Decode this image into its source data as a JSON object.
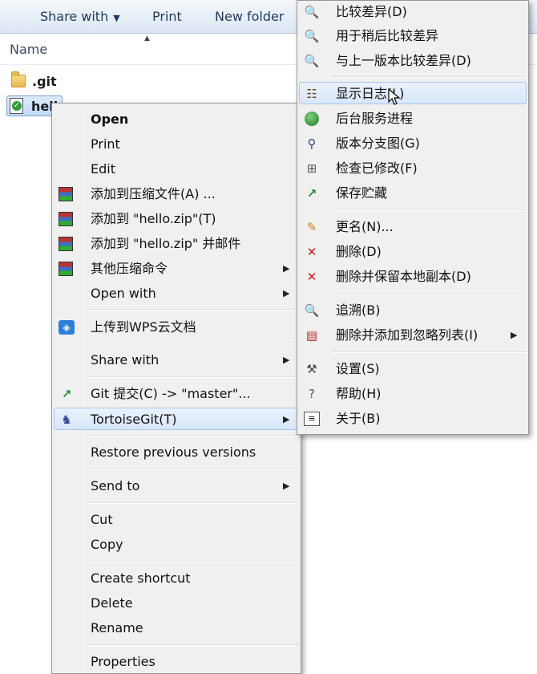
{
  "toolbar": {
    "share_with": "Share with",
    "print": "Print",
    "new_folder": "New folder"
  },
  "file_list": {
    "column_name": "Name",
    "files": [
      {
        "name": ".git",
        "type": "folder"
      },
      {
        "name": "hello.txt",
        "type": "document",
        "visible_text": "hell"
      }
    ]
  },
  "context_menu": {
    "items": [
      {
        "label": "Open",
        "bold": true
      },
      {
        "label": "Print"
      },
      {
        "label": "Edit"
      },
      {
        "label": "添加到压缩文件(A) ...",
        "icon": "archive-icon"
      },
      {
        "label": "添加到 \"hello.zip\"(T)",
        "icon": "archive-icon"
      },
      {
        "label": "添加到 \"hello.zip\" 并邮件",
        "icon": "archive-icon"
      },
      {
        "label": "其他压缩命令",
        "icon": "archive-icon",
        "submenu": true
      },
      {
        "label": "Open with",
        "submenu": true
      },
      {
        "label": "上传到WPS云文档",
        "icon": "wps-cloud-icon"
      },
      {
        "label": "Share with",
        "submenu": true
      },
      {
        "label": "Git 提交(C) -> \"master\"...",
        "icon": "git-commit-icon"
      },
      {
        "label": "TortoiseGit(T)",
        "icon": "tortoisegit-icon",
        "submenu": true
      },
      {
        "label": "Restore previous versions"
      },
      {
        "label": "Send to",
        "submenu": true
      },
      {
        "label": "Cut"
      },
      {
        "label": "Copy"
      },
      {
        "label": "Create shortcut"
      },
      {
        "label": "Delete"
      },
      {
        "label": "Rename"
      },
      {
        "label": "Properties"
      }
    ]
  },
  "tortoise_menu": {
    "items": [
      {
        "label": "比较差异(D)",
        "icon": "diff-magnifier-icon"
      },
      {
        "label": "用于稍后比较差异",
        "icon": "diff-later-icon"
      },
      {
        "label": "与上一版本比较差异(D)",
        "icon": "diff-previous-icon"
      },
      {
        "label": "显示日志(L)",
        "icon": "show-log-icon"
      },
      {
        "label": "后台服务进程",
        "icon": "daemon-globe-icon"
      },
      {
        "label": "版本分支图(G)",
        "icon": "revision-graph-icon"
      },
      {
        "label": "检查已修改(F)",
        "icon": "check-modifications-icon"
      },
      {
        "label": "保存贮藏",
        "icon": "stash-save-icon"
      },
      {
        "label": "更名(N)...",
        "icon": "rename-pencil-icon"
      },
      {
        "label": "删除(D)",
        "icon": "delete-x-icon"
      },
      {
        "label": "删除并保留本地副本(D)",
        "icon": "delete-keep-local-icon"
      },
      {
        "label": "追溯(B)",
        "icon": "blame-icon"
      },
      {
        "label": "删除并添加到忽略列表(I)",
        "icon": "ignore-list-icon",
        "submenu": true
      },
      {
        "label": "设置(S)",
        "icon": "settings-wrench-icon"
      },
      {
        "label": "帮助(H)",
        "icon": "help-icon"
      },
      {
        "label": "关于(B)",
        "icon": "about-icon"
      }
    ]
  },
  "colors": {
    "highlight": "#d7e6fa",
    "menu_bg": "#f0f0f0",
    "toolbar_text": "#1e395b"
  }
}
